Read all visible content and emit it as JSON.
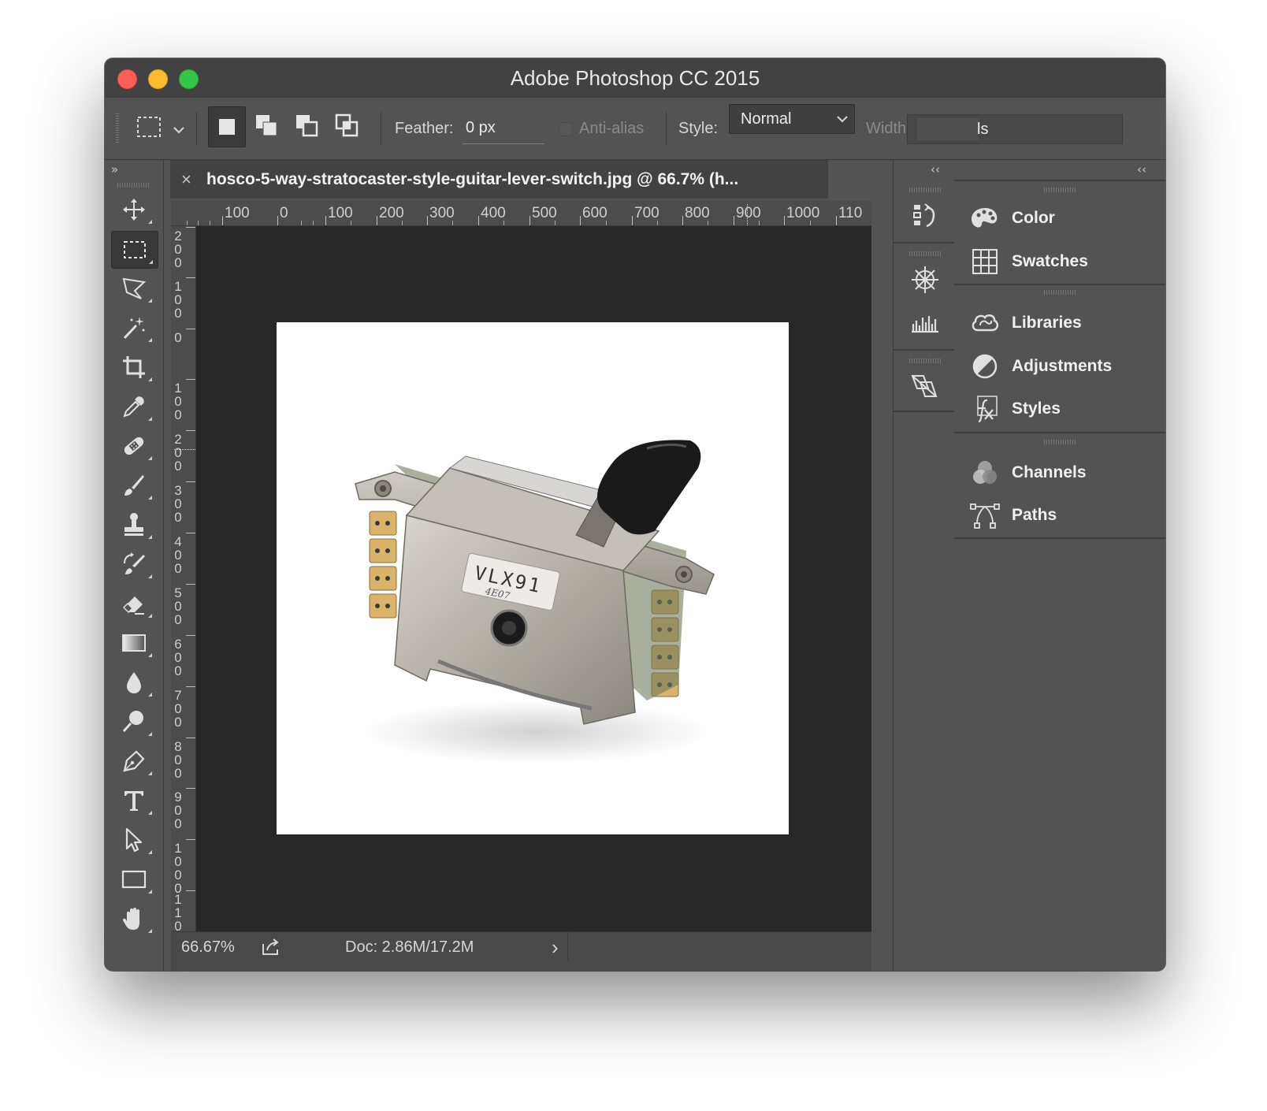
{
  "window": {
    "title": "Adobe Photoshop CC 2015"
  },
  "options_bar": {
    "feather_label": "Feather:",
    "feather_value": "0 px",
    "antialias_label": "Anti-alias",
    "style_label": "Style:",
    "style_value": "Normal",
    "width_label": "Width",
    "width_value": "ls"
  },
  "toolbox": {
    "collapse_glyph": "»",
    "tools": [
      "move-tool",
      "rectangular-marquee-tool",
      "lasso-tool",
      "magic-wand-tool",
      "crop-tool",
      "eyedropper-tool",
      "healing-brush-tool",
      "brush-tool",
      "clone-stamp-tool",
      "history-brush-tool",
      "eraser-tool",
      "gradient-tool",
      "blur-tool",
      "dodge-tool",
      "pen-tool",
      "type-tool",
      "path-selection-tool",
      "rectangle-tool",
      "hand-tool"
    ],
    "active_tool": "rectangular-marquee-tool"
  },
  "document": {
    "tab_close": "×",
    "tab_title": "hosco-5-way-stratocaster-style-guitar-lever-switch.jpg @ 66.7% (h...",
    "ruler_top_labels": [
      "100",
      "0",
      "100",
      "200",
      "300",
      "400",
      "500",
      "600",
      "700",
      "800",
      "900",
      "1000",
      "110"
    ],
    "ruler_left_labels": [
      "200",
      "100",
      "0",
      "100",
      "200",
      "300",
      "400",
      "500",
      "600",
      "700",
      "800",
      "900",
      "1000",
      "110"
    ],
    "image_label_text": "VLX91",
    "image_label_subtext": "4E07"
  },
  "status_bar": {
    "zoom": "66.67%",
    "doc_info": "Doc: 2.86M/17.2M",
    "arrow": "›"
  },
  "icon_strip": {
    "collapse_glyph": "‹‹",
    "icons": [
      "history-icon",
      "navigator-icon",
      "histogram-icon",
      "layer-comps-icon"
    ]
  },
  "panels": {
    "collapse_glyph": "‹‹",
    "groups": [
      {
        "items": [
          {
            "label": "Color",
            "icon": "color-icon"
          },
          {
            "label": "Swatches",
            "icon": "swatches-icon"
          }
        ]
      },
      {
        "items": [
          {
            "label": "Libraries",
            "icon": "libraries-icon"
          },
          {
            "label": "Adjustments",
            "icon": "adjustments-icon"
          },
          {
            "label": "Styles",
            "icon": "styles-icon"
          }
        ]
      },
      {
        "items": [
          {
            "label": "Channels",
            "icon": "channels-icon"
          },
          {
            "label": "Paths",
            "icon": "paths-icon"
          }
        ]
      }
    ]
  },
  "colors": {
    "close": "#fc5f57",
    "minimize": "#fdbc2e",
    "zoom": "#33c748",
    "ui_gray": "#535353",
    "canvas_pasteboard": "#282828"
  }
}
